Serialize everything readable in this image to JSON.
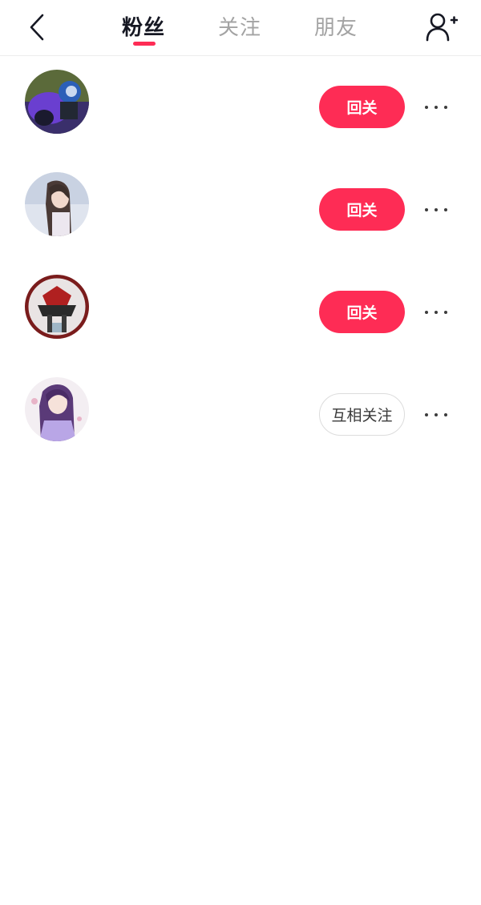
{
  "header": {
    "tabs": [
      {
        "label": "粉丝",
        "active": true
      },
      {
        "label": "关注",
        "active": false
      },
      {
        "label": "朋友",
        "active": false
      }
    ],
    "back_icon": "chevron-left-icon",
    "add_friend_icon": "person-add-icon"
  },
  "followers": [
    {
      "avatar": "motorcycle-rider",
      "button_label": "回关",
      "button_style": "primary"
    },
    {
      "avatar": "girl-long-hair",
      "button_label": "回关",
      "button_style": "primary"
    },
    {
      "avatar": "armored-warrior",
      "button_label": "回关",
      "button_style": "primary"
    },
    {
      "avatar": "anime-girl-purple",
      "button_label": "互相关注",
      "button_style": "mutual"
    }
  ],
  "colors": {
    "accent": "#fe2c55",
    "text_primary": "#161823",
    "text_inactive": "#a3a3a3"
  }
}
